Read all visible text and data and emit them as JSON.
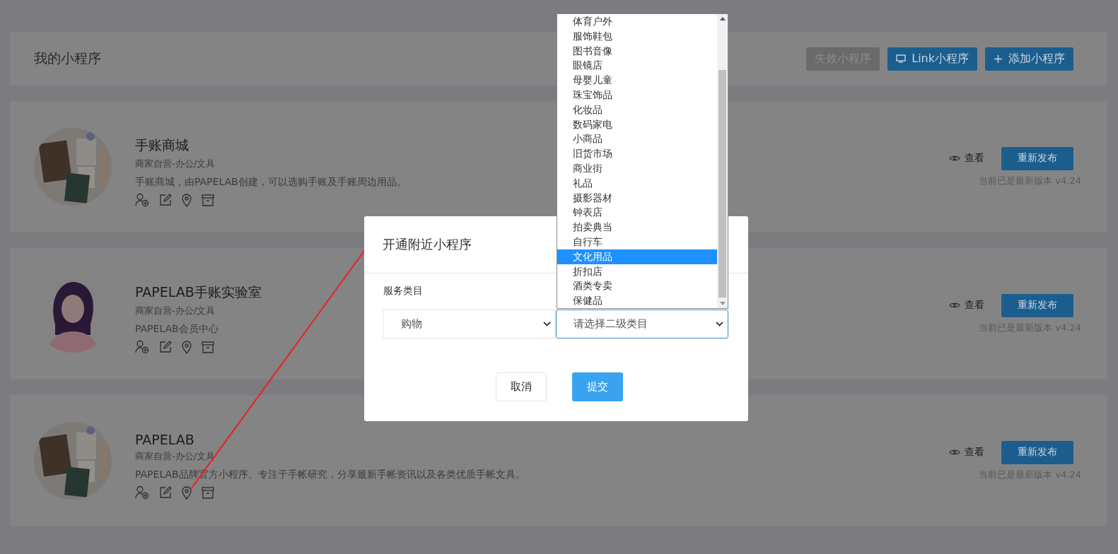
{
  "header": {
    "title": "我的小程序",
    "buttons": [
      {
        "label": "失效小程序",
        "kind": "disabled"
      },
      {
        "label": "Link小程序",
        "kind": "link"
      },
      {
        "label": "添加小程序",
        "kind": "add"
      }
    ]
  },
  "apps": [
    {
      "name": "手账商城",
      "category": "商家自营-办公/文具",
      "description": "手账商城，由PAPELAB创建，可以选购手账及手账周边用品。",
      "view_label": "查看",
      "publish_label": "重新发布",
      "version_note": "当前已是最新版本 v4.24"
    },
    {
      "name": "PAPELAB手账实验室",
      "category": "商家自营-办公/文具",
      "description": "PAPELAB会员中心",
      "avatar": {
        "kind": "figure"
      },
      "view_label": "查看",
      "publish_label": "重新发布",
      "version_note": "当前已是最新版本 v4.24"
    },
    {
      "name": "PAPELAB",
      "category": "商家自营-办公/文具",
      "description": "PAPELAB品牌官方小程序。专注于手帐研究，分享最新手帐资讯以及各类优质手帐文具。",
      "view_label": "查看",
      "publish_label": "重新发布",
      "version_note": "当前已是最新版本 v4.24"
    }
  ],
  "dialog": {
    "title": "开通附近小程序",
    "field_label": "服务类目",
    "primary_select": {
      "value": "购物"
    },
    "secondary_select": {
      "placeholder": "请选择二级类目"
    },
    "buttons": [
      {
        "label": "取消",
        "kind": "secondary"
      },
      {
        "label": "提交",
        "kind": "primary"
      }
    ]
  },
  "dropdown": {
    "options": [
      {
        "label": "体育户外",
        "selected": false
      },
      {
        "label": "服饰鞋包",
        "selected": false
      },
      {
        "label": "图书音像",
        "selected": false
      },
      {
        "label": "眼镜店",
        "selected": false
      },
      {
        "label": "母婴儿童",
        "selected": false
      },
      {
        "label": "珠宝饰品",
        "selected": false
      },
      {
        "label": "化妆品",
        "selected": false
      },
      {
        "label": "数码家电",
        "selected": false
      },
      {
        "label": "小商品",
        "selected": false
      },
      {
        "label": "旧货市场",
        "selected": false
      },
      {
        "label": "商业街",
        "selected": false
      },
      {
        "label": "礼品",
        "selected": false
      },
      {
        "label": "摄影器材",
        "selected": false
      },
      {
        "label": "钟表店",
        "selected": false
      },
      {
        "label": "拍卖典当",
        "selected": false
      },
      {
        "label": "自行车",
        "selected": false
      },
      {
        "label": "文化用品",
        "selected": true
      },
      {
        "label": "折扣店",
        "selected": false
      },
      {
        "label": "酒类专卖",
        "selected": false
      },
      {
        "label": "保健品",
        "selected": false
      }
    ]
  }
}
